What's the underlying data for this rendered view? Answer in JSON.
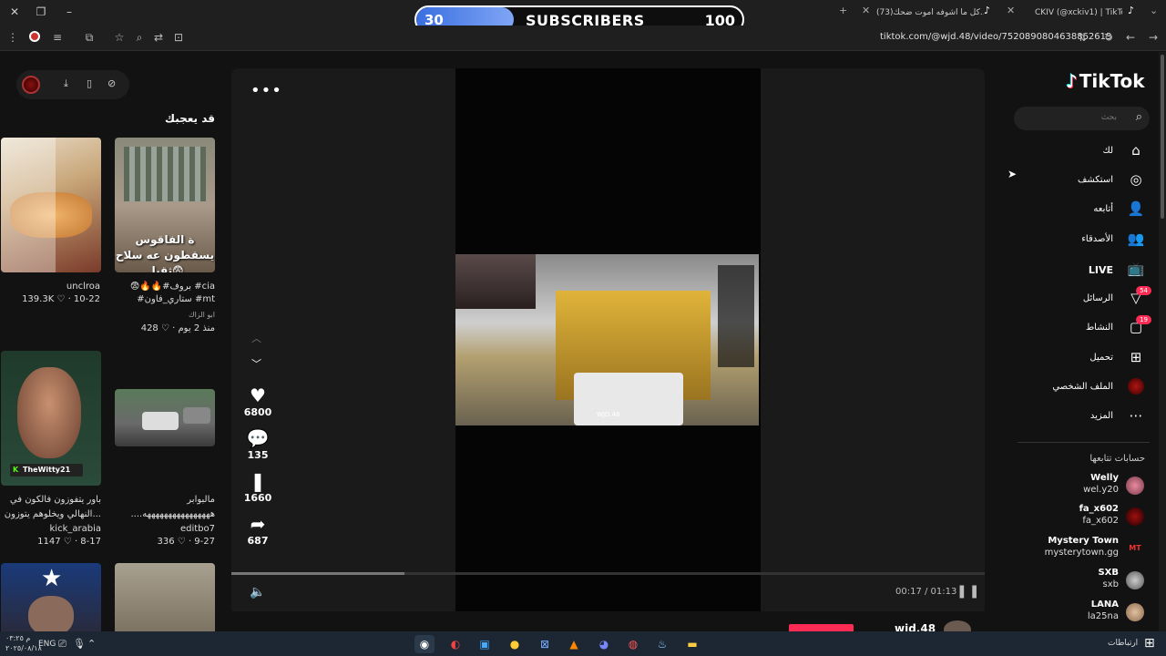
{
  "subscriber_bar": {
    "start": "30",
    "label": "SUBSCRIBERS",
    "end": "100",
    "progress": 0.3
  },
  "tabs": [
    {
      "title": "(73)كل ما اشوفه اموت ضحك..."
    },
    {
      "title": "CKIV (@xckiv1) | TikTok(54)"
    }
  ],
  "address_bar": {
    "url": "tiktok.com/@wjd.48/video/7520890804638862613"
  },
  "left_panel": {
    "title": "قد يعجبك",
    "cards": [
      {
        "author": "unclroa",
        "stats": "139.3K ♡ · 10-22"
      },
      {
        "caption1": "😨🔥🔥#بروف #cia",
        "caption2": "#ستاري_فاون #mt",
        "author": "ابو الزاك",
        "stats": "428 ♡ · منذ 2 يوم",
        "overlay": "ة الفاقوس يسقطون عه سلاح ثقيل😨"
      },
      {
        "caption1": "باور يتفوزون فالكون في",
        "caption2": "النهالي ويخلوهم يتوزون...",
        "author": "kick_arabia",
        "stats": "1147 ♡ · 8-17",
        "streamer_tag": "TheWitty21"
      },
      {
        "caption1": "مالبوابر",
        "caption2": "....ههههههههههههههههه",
        "author": "editbo7",
        "stats": "336 ♡ · 9-27"
      }
    ]
  },
  "video": {
    "likes": "6800",
    "comments": "135",
    "saves": "1660",
    "shares": "687",
    "time": "00:17 / 01:13",
    "progress": 0.23,
    "author_peek": "wjd.48",
    "watermark": "WJD.48"
  },
  "brand": {
    "name": "TikTok"
  },
  "search": {
    "placeholder": "بحث"
  },
  "nav": [
    {
      "label": "لك",
      "icon": "home-icon"
    },
    {
      "label": "استكشف",
      "icon": "compass-icon"
    },
    {
      "label": "أتابعه",
      "icon": "following-icon"
    },
    {
      "label": "الأصدقاء",
      "icon": "friends-icon"
    },
    {
      "label": "LIVE",
      "icon": "live-icon"
    },
    {
      "label": "الرسائل",
      "icon": "messages-icon",
      "badge": "54"
    },
    {
      "label": "النشاط",
      "icon": "activity-icon",
      "badge": "19"
    },
    {
      "label": "تحميل",
      "icon": "upload-icon"
    },
    {
      "label": "الملف الشخصي",
      "icon": "profile-icon"
    },
    {
      "label": "المزيد",
      "icon": "more-icon"
    }
  ],
  "following": {
    "title": "حسابات تتابعها",
    "accounts": [
      {
        "name": "Welly",
        "handle": "wel.y20"
      },
      {
        "name": "fa_x602",
        "handle": "fa_x602"
      },
      {
        "name": "Mystery Town",
        "handle": "mysterytown.gg",
        "avatar_text": "MT"
      },
      {
        "name": "SXB",
        "handle": "sxb"
      },
      {
        "name": "LANA",
        "handle": "la25na"
      }
    ]
  },
  "taskbar": {
    "time": "م ٠٣:٢٥",
    "date": "٢٠٢٥/٠٨/١٨",
    "lang": "ENG",
    "right_label": "ارتباطات"
  },
  "colors": {
    "accent": "#fe2c55",
    "background": "#121212",
    "subscriber_fill": "#5b8af0"
  }
}
